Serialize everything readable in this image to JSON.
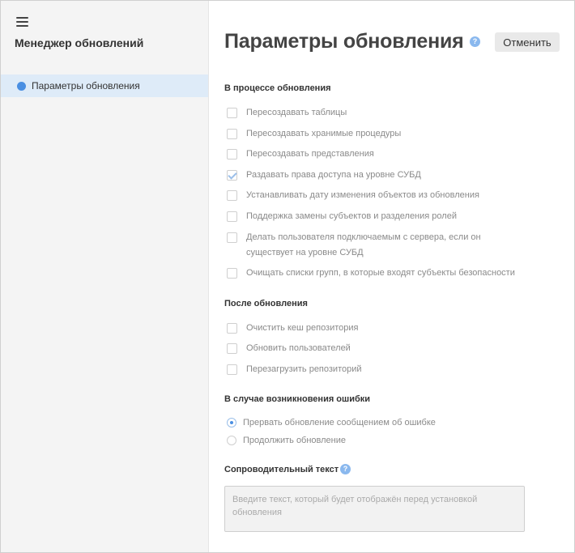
{
  "sidebar": {
    "title": "Менеджер обновлений",
    "items": [
      {
        "label": "Параметры обновления",
        "active": true
      }
    ]
  },
  "header": {
    "title": "Параметры обновления",
    "cancel_label": "Отменить"
  },
  "sections": {
    "during": {
      "title": "В процессе обновления",
      "options": [
        {
          "label": "Пересоздавать таблицы",
          "checked": false
        },
        {
          "label": "Пересоздавать хранимые процедуры",
          "checked": false
        },
        {
          "label": "Пересоздавать представления",
          "checked": false
        },
        {
          "label": "Раздавать права доступа на уровне СУБД",
          "checked": true
        },
        {
          "label": "Устанавливать дату изменения объектов из обновления",
          "checked": false
        },
        {
          "label": "Поддержка замены субъектов и разделения ролей",
          "checked": false
        },
        {
          "label": "Делать пользователя подключаемым с сервера, если он существует на уровне СУБД",
          "checked": false
        },
        {
          "label": "Очищать списки групп, в которые входят субъекты безопасности",
          "checked": false
        }
      ]
    },
    "after": {
      "title": "После обновления",
      "options": [
        {
          "label": "Очистить кеш репозитория",
          "checked": false
        },
        {
          "label": "Обновить пользователей",
          "checked": false
        },
        {
          "label": "Перезагрузить репозиторий",
          "checked": false
        }
      ]
    },
    "on_error": {
      "title": "В случае возникновения ошибки",
      "options": [
        {
          "label": "Прервать обновление сообщением об ошибке",
          "selected": true
        },
        {
          "label": "Продолжить обновление",
          "selected": false
        }
      ]
    },
    "accompanying": {
      "title": "Сопроводительный текст",
      "placeholder": "Введите текст, который будет отображён перед установкой обновления",
      "value": ""
    }
  },
  "colors": {
    "accent": "#4a8fe2",
    "sidebar_bg": "#f4f4f4",
    "active_item_bg": "#deebf8",
    "help_icon": "#8ab8ee"
  },
  "icons": {
    "menu": "hamburger-icon",
    "help": "question-circle-icon",
    "nav_dot": "dot-icon"
  }
}
